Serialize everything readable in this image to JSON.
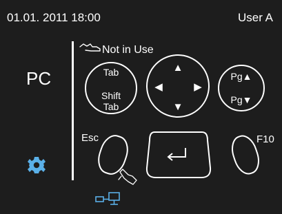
{
  "status_bar": {
    "datetime": "01.01. 2011 18:00",
    "user": "User A"
  },
  "sidebar": {
    "mode_label": "PC",
    "settings_icon": "gear-icon",
    "gear_color": "#5ab0e8"
  },
  "usage": {
    "label": "Not in Use",
    "icon": "hand-pointer-icon"
  },
  "keys": {
    "tab": "Tab",
    "shift_tab_line1": "Shift",
    "shift_tab_line2": "Tab",
    "pg_up": "Pg▲",
    "pg_down": "Pg▼",
    "esc": "Esc",
    "f10": "F10",
    "dpad": {
      "up": "▲",
      "down": "▼",
      "left": "◀",
      "right": "▶"
    }
  },
  "footer": {
    "connection_icon": "pc-connection-icon",
    "connection_color": "#5ab0e8"
  },
  "colors": {
    "background": "#1d1d1d",
    "foreground": "#ffffff",
    "accent": "#5ab0e8"
  }
}
